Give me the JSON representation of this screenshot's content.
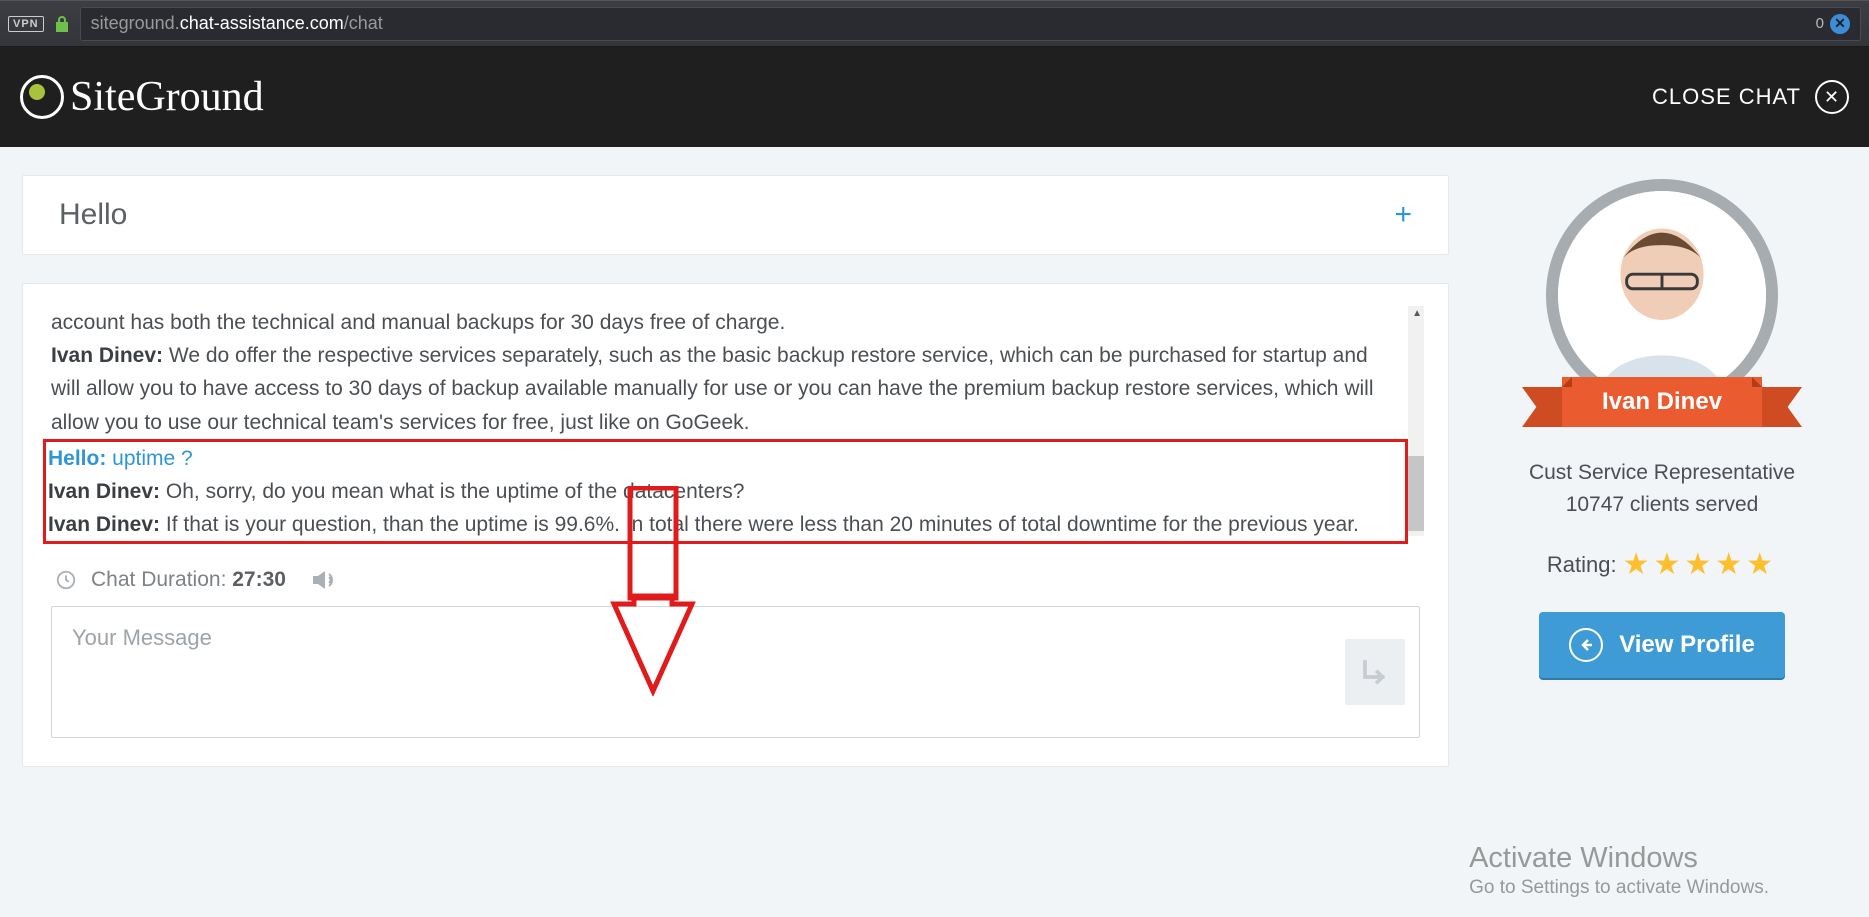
{
  "browser": {
    "vpn_label": "VPN",
    "url_dim_left": "siteground.",
    "url_highlight": "chat-assistance.com",
    "url_dim_right": "/chat",
    "badge_count": "0"
  },
  "header": {
    "brand": "SiteGround",
    "close_label": "CLOSE CHAT"
  },
  "chat_title": "Hello",
  "messages": {
    "m0_text": "account has both the technical and manual backups for 30 days free of charge.",
    "m1_sender": "Ivan Dinev:",
    "m1_text": " We do offer the respective services separately, such as the basic backup restore service, which can be purchased for startup and will allow you to have access to 30 days of backup available manually for use or you can have the premium backup restore services, which will allow you to use our technical team's services for free, just like on GoGeek.",
    "m2_sender": "Hello:",
    "m2_text": " uptime ?",
    "m3_sender": "Ivan Dinev:",
    "m3_text": " Oh, sorry, do you mean what is the uptime of the datacenters?",
    "m4_sender": "Ivan Dinev:",
    "m4_text": " If that is your question, than the uptime is 99.6%. In total there were less than 20 minutes of total downtime for the previous year."
  },
  "duration": {
    "label": "Chat Duration: ",
    "value": "27:30"
  },
  "input": {
    "placeholder": "Your Message"
  },
  "agent": {
    "name": "Ivan Dinev",
    "role": "Cust Service Representative",
    "served": "10747 clients served",
    "rating_label": "Rating:",
    "stars": "★★★★★",
    "view_label": "View Profile"
  },
  "watermark": {
    "line1": "Activate Windows",
    "line2": "Go to Settings to activate Windows."
  }
}
